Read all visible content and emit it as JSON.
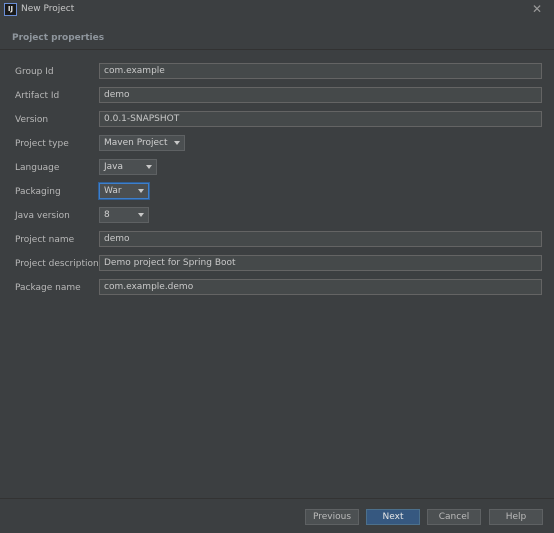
{
  "window": {
    "title": "New Project",
    "close_symbol": "✕",
    "icon_glyph": "IJ"
  },
  "section": {
    "title": "Project properties"
  },
  "fields": {
    "group_id": {
      "label": "Group Id",
      "value": "com.example"
    },
    "artifact_id": {
      "label": "Artifact Id",
      "value": "demo"
    },
    "version": {
      "label": "Version",
      "value": "0.0.1-SNAPSHOT"
    },
    "project_type": {
      "label": "Project type",
      "value": "Maven Project"
    },
    "language": {
      "label": "Language",
      "value": "Java"
    },
    "packaging": {
      "label": "Packaging",
      "value": "War"
    },
    "java_version": {
      "label": "Java version",
      "value": "8"
    },
    "project_name": {
      "label": "Project name",
      "value": "demo"
    },
    "project_description": {
      "label": "Project description",
      "value": "Demo project for Spring Boot"
    },
    "package_name": {
      "label": "Package name",
      "value": "com.example.demo"
    }
  },
  "buttons": {
    "previous": "Previous",
    "next": "Next",
    "cancel": "Cancel",
    "help": "Help"
  },
  "colors": {
    "background": "#3c3f41",
    "accent_blue": "#365880",
    "focus_blue": "#3d7fcc",
    "text": "#bbbbbb"
  }
}
